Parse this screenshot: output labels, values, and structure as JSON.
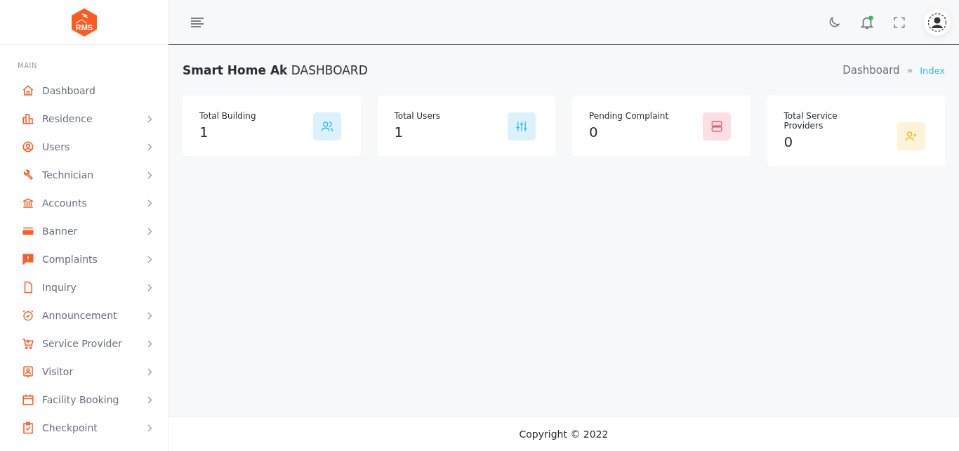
{
  "logo": {
    "text": "RMS"
  },
  "sidebar": {
    "section_label": "MAIN",
    "items": [
      {
        "label": "Dashboard",
        "kind": "home",
        "has_submenu": false
      },
      {
        "label": "Residence",
        "kind": "buildings",
        "has_submenu": true
      },
      {
        "label": "Users",
        "kind": "person",
        "has_submenu": true
      },
      {
        "label": "Technician",
        "kind": "wrench",
        "has_submenu": true
      },
      {
        "label": "Accounts",
        "kind": "bank",
        "has_submenu": true
      },
      {
        "label": "Banner",
        "kind": "card",
        "has_submenu": true
      },
      {
        "label": "Complaints",
        "kind": "alert",
        "has_submenu": true
      },
      {
        "label": "Inquiry",
        "kind": "file",
        "has_submenu": true
      },
      {
        "label": "Announcement",
        "kind": "alarm",
        "has_submenu": true
      },
      {
        "label": "Service Provider",
        "kind": "cart",
        "has_submenu": true
      },
      {
        "label": "Visitor",
        "kind": "badge",
        "has_submenu": true
      },
      {
        "label": "Facility Booking",
        "kind": "calendar",
        "has_submenu": true
      },
      {
        "label": "Checkpoint",
        "kind": "clipboard",
        "has_submenu": true
      }
    ]
  },
  "header": {
    "notifications_unread": true
  },
  "page": {
    "title_bold": "Smart Home Ak",
    "title_rest": "DASHBOARD",
    "breadcrumb": [
      {
        "label": "Dashboard",
        "selected": false
      },
      {
        "label": "Index",
        "selected": true
      }
    ],
    "breadcrumb_separator": "»"
  },
  "cards": [
    {
      "title": "Total Building",
      "value": "1",
      "kind": "users",
      "color": "#35b6f0"
    },
    {
      "title": "Total Users",
      "value": "1",
      "kind": "sliders",
      "color": "#35b6f0"
    },
    {
      "title": "Pending Complaint",
      "value": "0",
      "kind": "server",
      "color": "#f0506e"
    },
    {
      "title": "Total Service Providers",
      "value": "0",
      "kind": "userx",
      "color": "#f7b924"
    }
  ],
  "footer": {
    "text": "Copyright © 2022"
  }
}
